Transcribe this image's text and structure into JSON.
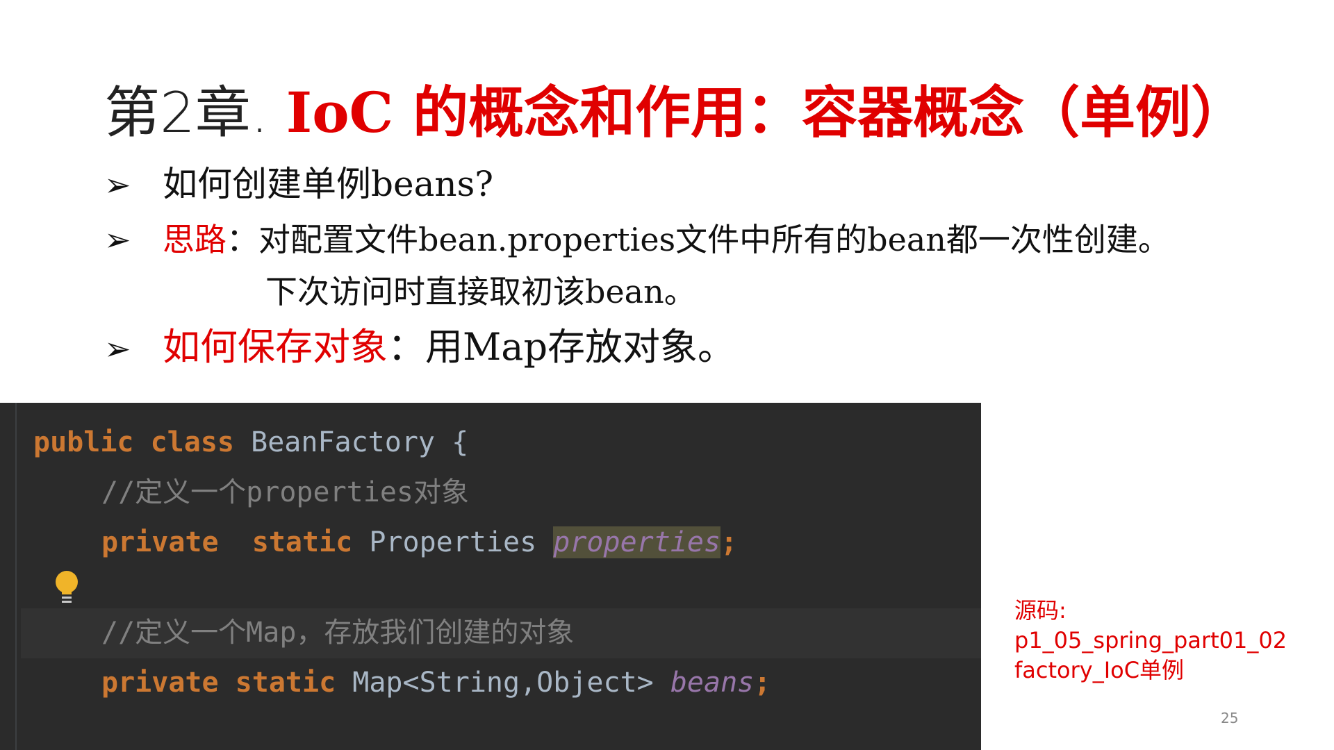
{
  "slide": {
    "title_prefix": "第2章.",
    "title_main": "IoC 的概念和作用：容器概念（单例）",
    "bullet_marker": "➢",
    "bullets": [
      {
        "text": "如何创建单例beans?"
      },
      {
        "label": "思路",
        "text": "：对配置文件bean.properties文件中所有的bean都一次性创建。",
        "continuation": "下次访问时直接取初该bean。"
      },
      {
        "label": "如何保存对象",
        "text": "：用Map存放对象。"
      }
    ],
    "page_number": "25"
  },
  "code": {
    "line1_kw1": "public",
    "line1_kw2": "class",
    "line1_rest": "BeanFactory {",
    "comment1": "//定义一个properties对象",
    "line3_kw1": "private",
    "line3_kw2": "static",
    "line3_type": "Properties",
    "line3_field": "properties",
    "semicolon": ";",
    "comment2": "//定义一个Map，存放我们创建的对象",
    "line6_kw1": "private",
    "line6_kw2": "static",
    "line6_type": "Map<String,Object>",
    "line6_field": "beans",
    "colors": {
      "keyword": "#cc7832",
      "comment": "#808080",
      "field": "#9876aa",
      "text": "#a9b7c6",
      "background": "#2b2b2b"
    },
    "gutter_icon": "lightbulb-icon"
  },
  "source_note": {
    "label": "源码:",
    "line1": "p1_05_spring_part01_02",
    "line2": "factory_IoC单例"
  },
  "accent_color": "#e00000"
}
